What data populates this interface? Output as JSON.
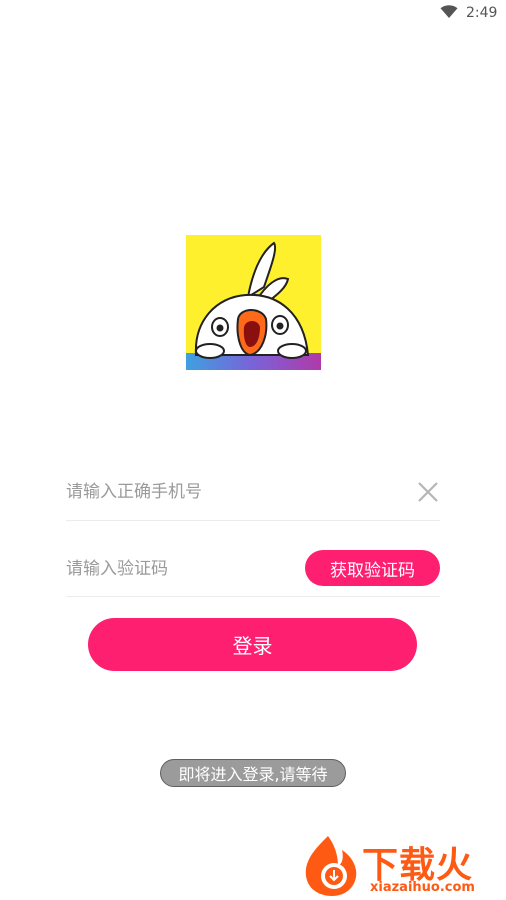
{
  "status_bar": {
    "time": "2:49",
    "wifi_icon": "wifi-icon"
  },
  "app": {
    "logo_icon": "cockatoo-mascot-logo"
  },
  "login_form": {
    "phone_placeholder": "请输入正确手机号",
    "phone_value": "",
    "clear_icon": "close-icon",
    "code_placeholder": "请输入验证码",
    "code_value": "",
    "get_code_label": "获取验证码",
    "login_label": "登录"
  },
  "toast": {
    "message": "即将进入登录,请等待"
  },
  "watermark": {
    "title": "下载火",
    "domain": "xiazaihuo.com"
  },
  "colors": {
    "accent": "#ff1f71",
    "watermark": "#ff5a14",
    "toast_bg": "#9b9b9b"
  }
}
